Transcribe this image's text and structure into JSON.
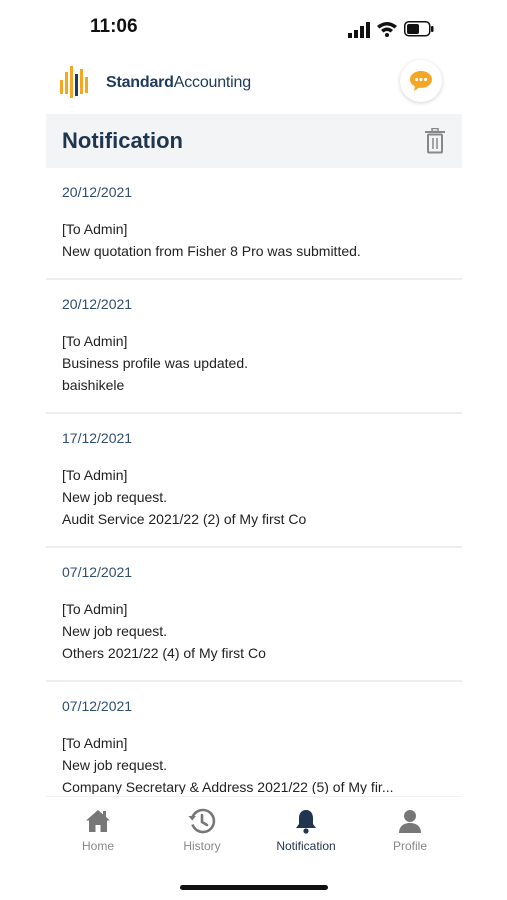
{
  "status_bar": {
    "time": "11:06"
  },
  "header": {
    "brand_bold": "Standard",
    "brand_regular": "Accounting"
  },
  "page": {
    "title": "Notification"
  },
  "notifications": [
    {
      "date": "20/12/2021",
      "lines": [
        "[To Admin]",
        "New quotation from Fisher 8 Pro was submitted."
      ]
    },
    {
      "date": "20/12/2021",
      "lines": [
        "[To Admin]",
        "Business profile was updated.",
        "baishikele"
      ]
    },
    {
      "date": "17/12/2021",
      "lines": [
        "[To Admin]",
        "New job request.",
        "Audit Service 2021/22 (2) of My first Co"
      ]
    },
    {
      "date": "07/12/2021",
      "lines": [
        "[To Admin]",
        "New job request.",
        "Others 2021/22 (4) of My first Co"
      ]
    },
    {
      "date": "07/12/2021",
      "lines": [
        "[To Admin]",
        "New job request.",
        "Company Secretary & Address 2021/22 (5) of My fir..."
      ]
    }
  ],
  "tabs": [
    {
      "label": "Home",
      "icon": "home-icon"
    },
    {
      "label": "History",
      "icon": "history-icon"
    },
    {
      "label": "Notification",
      "icon": "bell-icon",
      "active": true
    },
    {
      "label": "Profile",
      "icon": "person-icon"
    }
  ],
  "colors": {
    "brand_navy": "#1f3550",
    "accent_orange": "#f5a623",
    "date_blue": "#2e4f73"
  }
}
